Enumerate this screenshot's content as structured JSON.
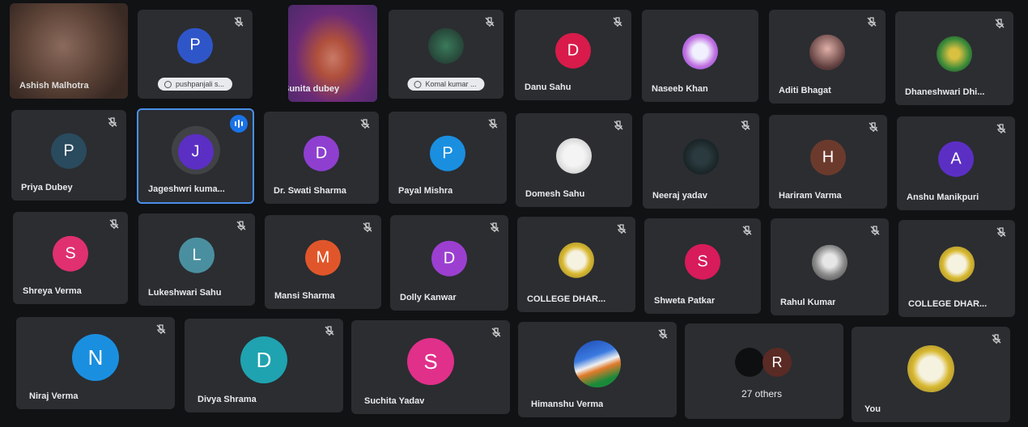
{
  "participants": [
    {
      "name": "Ashish Malhotra",
      "type": "video"
    },
    {
      "name": "pushpanjali s...",
      "initial": "P",
      "color": "#2f56c9",
      "type": "pill"
    },
    {
      "name": "Sunita dubey",
      "type": "video"
    },
    {
      "name": "Komal kumar ...",
      "type": "pill-photo"
    },
    {
      "name": "Danu Sahu",
      "initial": "D",
      "color": "#d81b4a"
    },
    {
      "name": "Naseeb Khan",
      "type": "photo"
    },
    {
      "name": "Aditi Bhagat",
      "type": "photo"
    },
    {
      "name": "Dhaneshwari Dhi...",
      "type": "photo"
    },
    {
      "name": "Priya Dubey",
      "initial": "P",
      "color": "#2a4a5e"
    },
    {
      "name": "Jageshwri kuma...",
      "initial": "J",
      "color": "#5b2fc4",
      "type": "speaking"
    },
    {
      "name": "Dr. Swati Sharma",
      "initial": "D",
      "color": "#8e3fd0"
    },
    {
      "name": "Payal Mishra",
      "initial": "P",
      "color": "#1a8fe0"
    },
    {
      "name": "Domesh Sahu",
      "type": "photo"
    },
    {
      "name": "Neeraj yadav",
      "type": "photo"
    },
    {
      "name": "Hariram Varma",
      "initial": "H",
      "color": "#6b3a2c"
    },
    {
      "name": "Anshu Manikpuri",
      "initial": "A",
      "color": "#5b2fc4"
    },
    {
      "name": "Shreya Verma",
      "initial": "S",
      "color": "#e0306f"
    },
    {
      "name": "Lukeshwari Sahu",
      "initial": "L",
      "color": "#4a8fa0"
    },
    {
      "name": "Mansi Sharma",
      "initial": "M",
      "color": "#e0562a"
    },
    {
      "name": "Dolly Kanwar",
      "initial": "D",
      "color": "#9c3fd0"
    },
    {
      "name": "COLLEGE DHAR...",
      "type": "logo"
    },
    {
      "name": "Shweta Patkar",
      "initial": "S",
      "color": "#d81b5a"
    },
    {
      "name": "Rahul Kumar",
      "type": "photo"
    },
    {
      "name": "COLLEGE DHAR...",
      "type": "logo"
    },
    {
      "name": "Niraj Verma",
      "initial": "N",
      "color": "#1a8fe0"
    },
    {
      "name": "Divya Shrama",
      "initial": "D",
      "color": "#1fa3b0"
    },
    {
      "name": "Suchita Yadav",
      "initial": "S",
      "color": "#e0308a"
    },
    {
      "name": "Himanshu Verma",
      "type": "photo"
    },
    {
      "name": "27 others",
      "type": "others",
      "initial": "R"
    },
    {
      "name": "You",
      "type": "logo"
    }
  ]
}
